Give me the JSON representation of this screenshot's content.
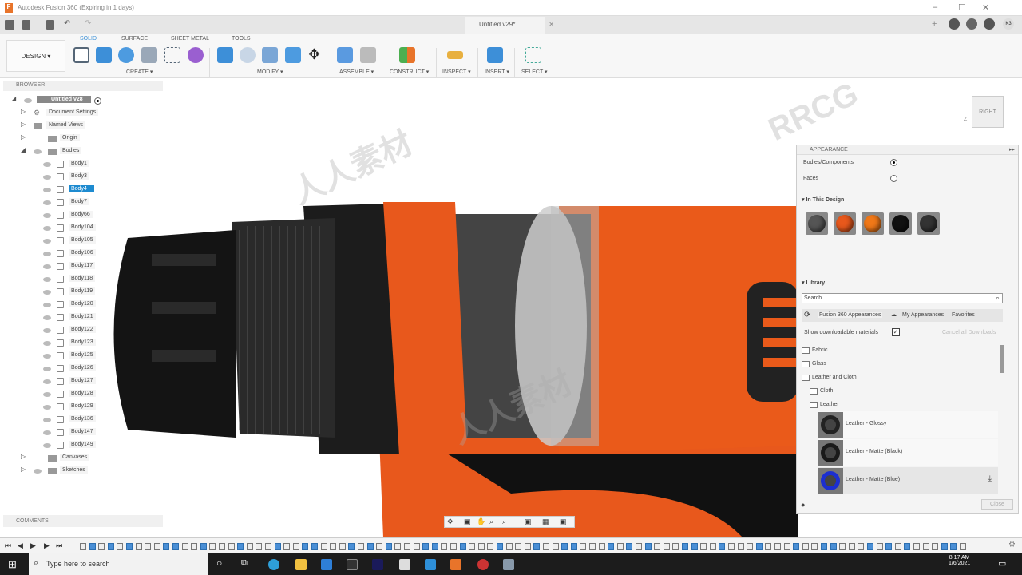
{
  "window": {
    "title": "Autodesk Fusion 360 (Expiring in 1 days)",
    "minimize": "–",
    "maximize": "☐",
    "close": "✕"
  },
  "document_tab": {
    "label": "Untitled v29*",
    "close": "✕"
  },
  "ribbon": {
    "workspace": "DESIGN ▾",
    "tabs": [
      "SOLID",
      "SURFACE",
      "SHEET METAL",
      "TOOLS"
    ],
    "groups": [
      "CREATE ▾",
      "MODIFY ▾",
      "ASSEMBLE ▾",
      "CONSTRUCT ▾",
      "INSPECT ▾",
      "INSERT ▾",
      "SELECT ▾"
    ]
  },
  "user_initials": "K3",
  "browser": {
    "title": "BROWSER",
    "root": "Untitled v28",
    "nodes": [
      "Document Settings",
      "Named Views",
      "Origin",
      "Bodies"
    ],
    "bodies": [
      "Body1",
      "Body3",
      "Body4",
      "Body7",
      "Body66",
      "Body104",
      "Body105",
      "Body106",
      "Body117",
      "Body118",
      "Body119",
      "Body120",
      "Body121",
      "Body122",
      "Body123",
      "Body125",
      "Body126",
      "Body127",
      "Body128",
      "Body129",
      "Body136",
      "Body147",
      "Body149"
    ],
    "selected": "Body4",
    "after": [
      "Canvases",
      "Sketches"
    ]
  },
  "viewcube": {
    "face": "RIGHT",
    "axis": "Z"
  },
  "appearance": {
    "title": "APPEARANCE",
    "apply_to": [
      {
        "label": "Bodies/Components",
        "selected": true
      },
      {
        "label": "Faces",
        "selected": false
      }
    ],
    "in_design_title": "In This Design",
    "in_design_colors": [
      "#555555",
      "#e8581c",
      "#f07818",
      "#111111",
      "#333333"
    ],
    "library_title": "Library",
    "search_placeholder": "Search",
    "lib_tabs": [
      "Fusion 360 Appearances",
      "My Appearances",
      "Favorites"
    ],
    "show_downloadable": "Show downloadable materials",
    "show_downloadable_checked": true,
    "cancel_downloads": "Cancel all Downloads",
    "folders": [
      "Fabric",
      "Glass",
      "Leather and Cloth",
      "Cloth",
      "Leather"
    ],
    "materials": [
      {
        "name": "Leather - Glossy",
        "color": "#222222"
      },
      {
        "name": "Leather - Matte (Black)",
        "color": "#1a1a1a"
      },
      {
        "name": "Leather - Matte (Blue)",
        "color": "#1c2fd0"
      }
    ],
    "close": "Close"
  },
  "comments": {
    "title": "COMMENTS"
  },
  "taskbar": {
    "search_placeholder": "Type here to search",
    "time": "8:17 AM",
    "date": "1/6/2021"
  },
  "watermark": [
    "RRCG",
    "人人素材"
  ]
}
